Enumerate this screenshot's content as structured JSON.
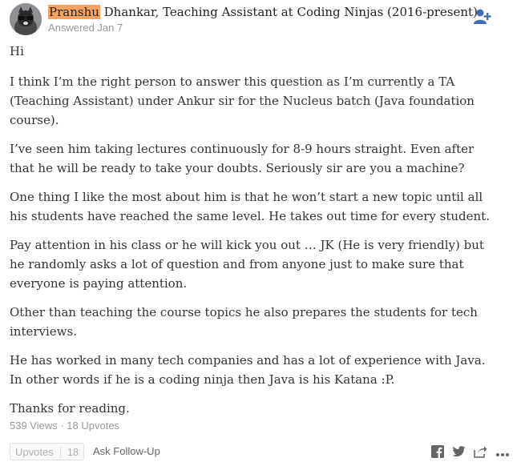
{
  "author": {
    "first_name": "Pranshu",
    "rest_of_name": " Dhankar, Teaching Assistant at Coding Ninjas (2016-present)",
    "answered": "Answered Jan 7"
  },
  "paragraphs": [
    "Hi",
    "I think I’m the right person to answer this question as I’m currently a TA (Teaching Assistant) under Ankur sir for the Nucleus batch (Java foundation course).",
    "I’ve seen him taking lectures continuously for 8-9 hours straight. Even after that he will be ready to take your doubts. Seriously sir are you a machine?",
    "One thing I like the most about him is that he won’t start a new topic until all his students have reached the same level. He takes out time for every student.",
    "Pay attention in his class or he will kick you out … JK (He is very friendly) but he randomly asks a lot of question and from anyone just to make sure that everyone is paying attention.",
    "Other than teaching the course topics he also prepares the students for tech interviews.",
    "He has worked in many tech companies and has a lot of experience with Java. In other words if he is a coding ninja then Java is his Katana :P.",
    "Thanks for reading."
  ],
  "stats": "539 Views · 18 Upvotes",
  "actions": {
    "upvote_label": "Upvotes",
    "upvote_count": "18",
    "followup_label": "Ask Follow-Up"
  },
  "icons": [
    "follow-user-icon",
    "facebook-icon",
    "twitter-icon",
    "share-icon",
    "more-icon"
  ],
  "colors": {
    "highlight": "#f4a460",
    "follow_icon": "#3e6fb8",
    "muted": "#999999"
  }
}
